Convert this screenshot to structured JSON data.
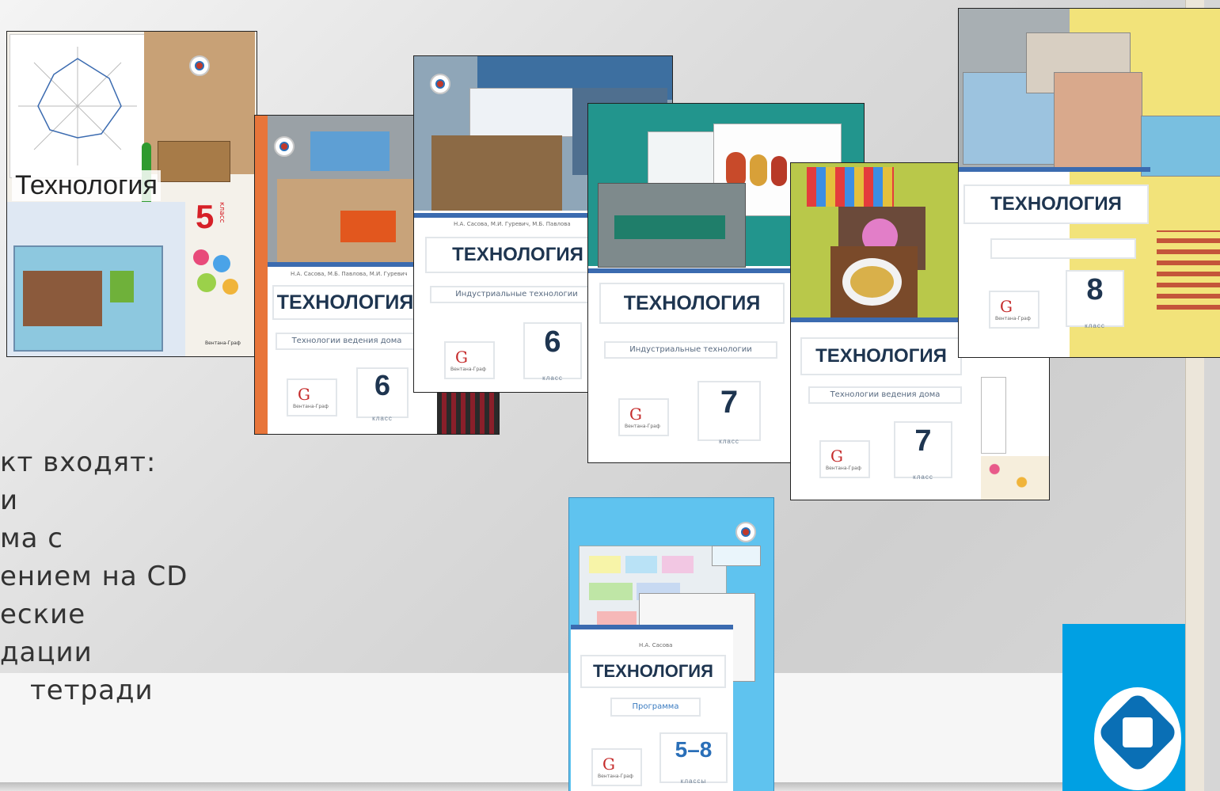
{
  "bullets": [
    "кт входят:",
    "и",
    "ма с",
    "ением на CD",
    "еские",
    "дации",
    "тетради"
  ],
  "covers": {
    "c5": {
      "title": "Технология",
      "grade": "5",
      "grade_suffix": "класс"
    },
    "c6a": {
      "title": "ТЕХНОЛОГИЯ",
      "subtitle": "Технологии ведения дома",
      "grade": "6",
      "grade_word": "класс",
      "authors": "Н.А. Сасова, М.Б. Павлова, М.И. Гуревич"
    },
    "c6b": {
      "title": "ТЕХНОЛОГИЯ",
      "subtitle": "Индустриальные технологии",
      "grade": "6",
      "grade_word": "класс",
      "authors": "Н.А. Сасова, М.И. Гуревич, М.Б. Павлова"
    },
    "c7a": {
      "title": "ТЕХНОЛОГИЯ",
      "subtitle": "Индустриальные технологии",
      "grade": "7",
      "grade_word": "класс"
    },
    "c7b": {
      "title": "ТЕХНОЛОГИЯ",
      "subtitle": "Технологии ведения дома",
      "grade": "7",
      "grade_word": "класс"
    },
    "c8": {
      "title": "ТЕХНОЛОГИЯ",
      "grade": "8",
      "grade_word": "класс"
    },
    "prog": {
      "title": "ТЕХНОЛОГИЯ",
      "subtitle": "Программа",
      "grade": "5–8",
      "grade_word": "классы",
      "authors": "Н.А. Сасова"
    }
  },
  "publisher": "Вентана-Граф",
  "colors": {
    "accent_blue": "#00a0e3",
    "title_navy": "#1e3550",
    "grade5_red": "#d62027"
  }
}
